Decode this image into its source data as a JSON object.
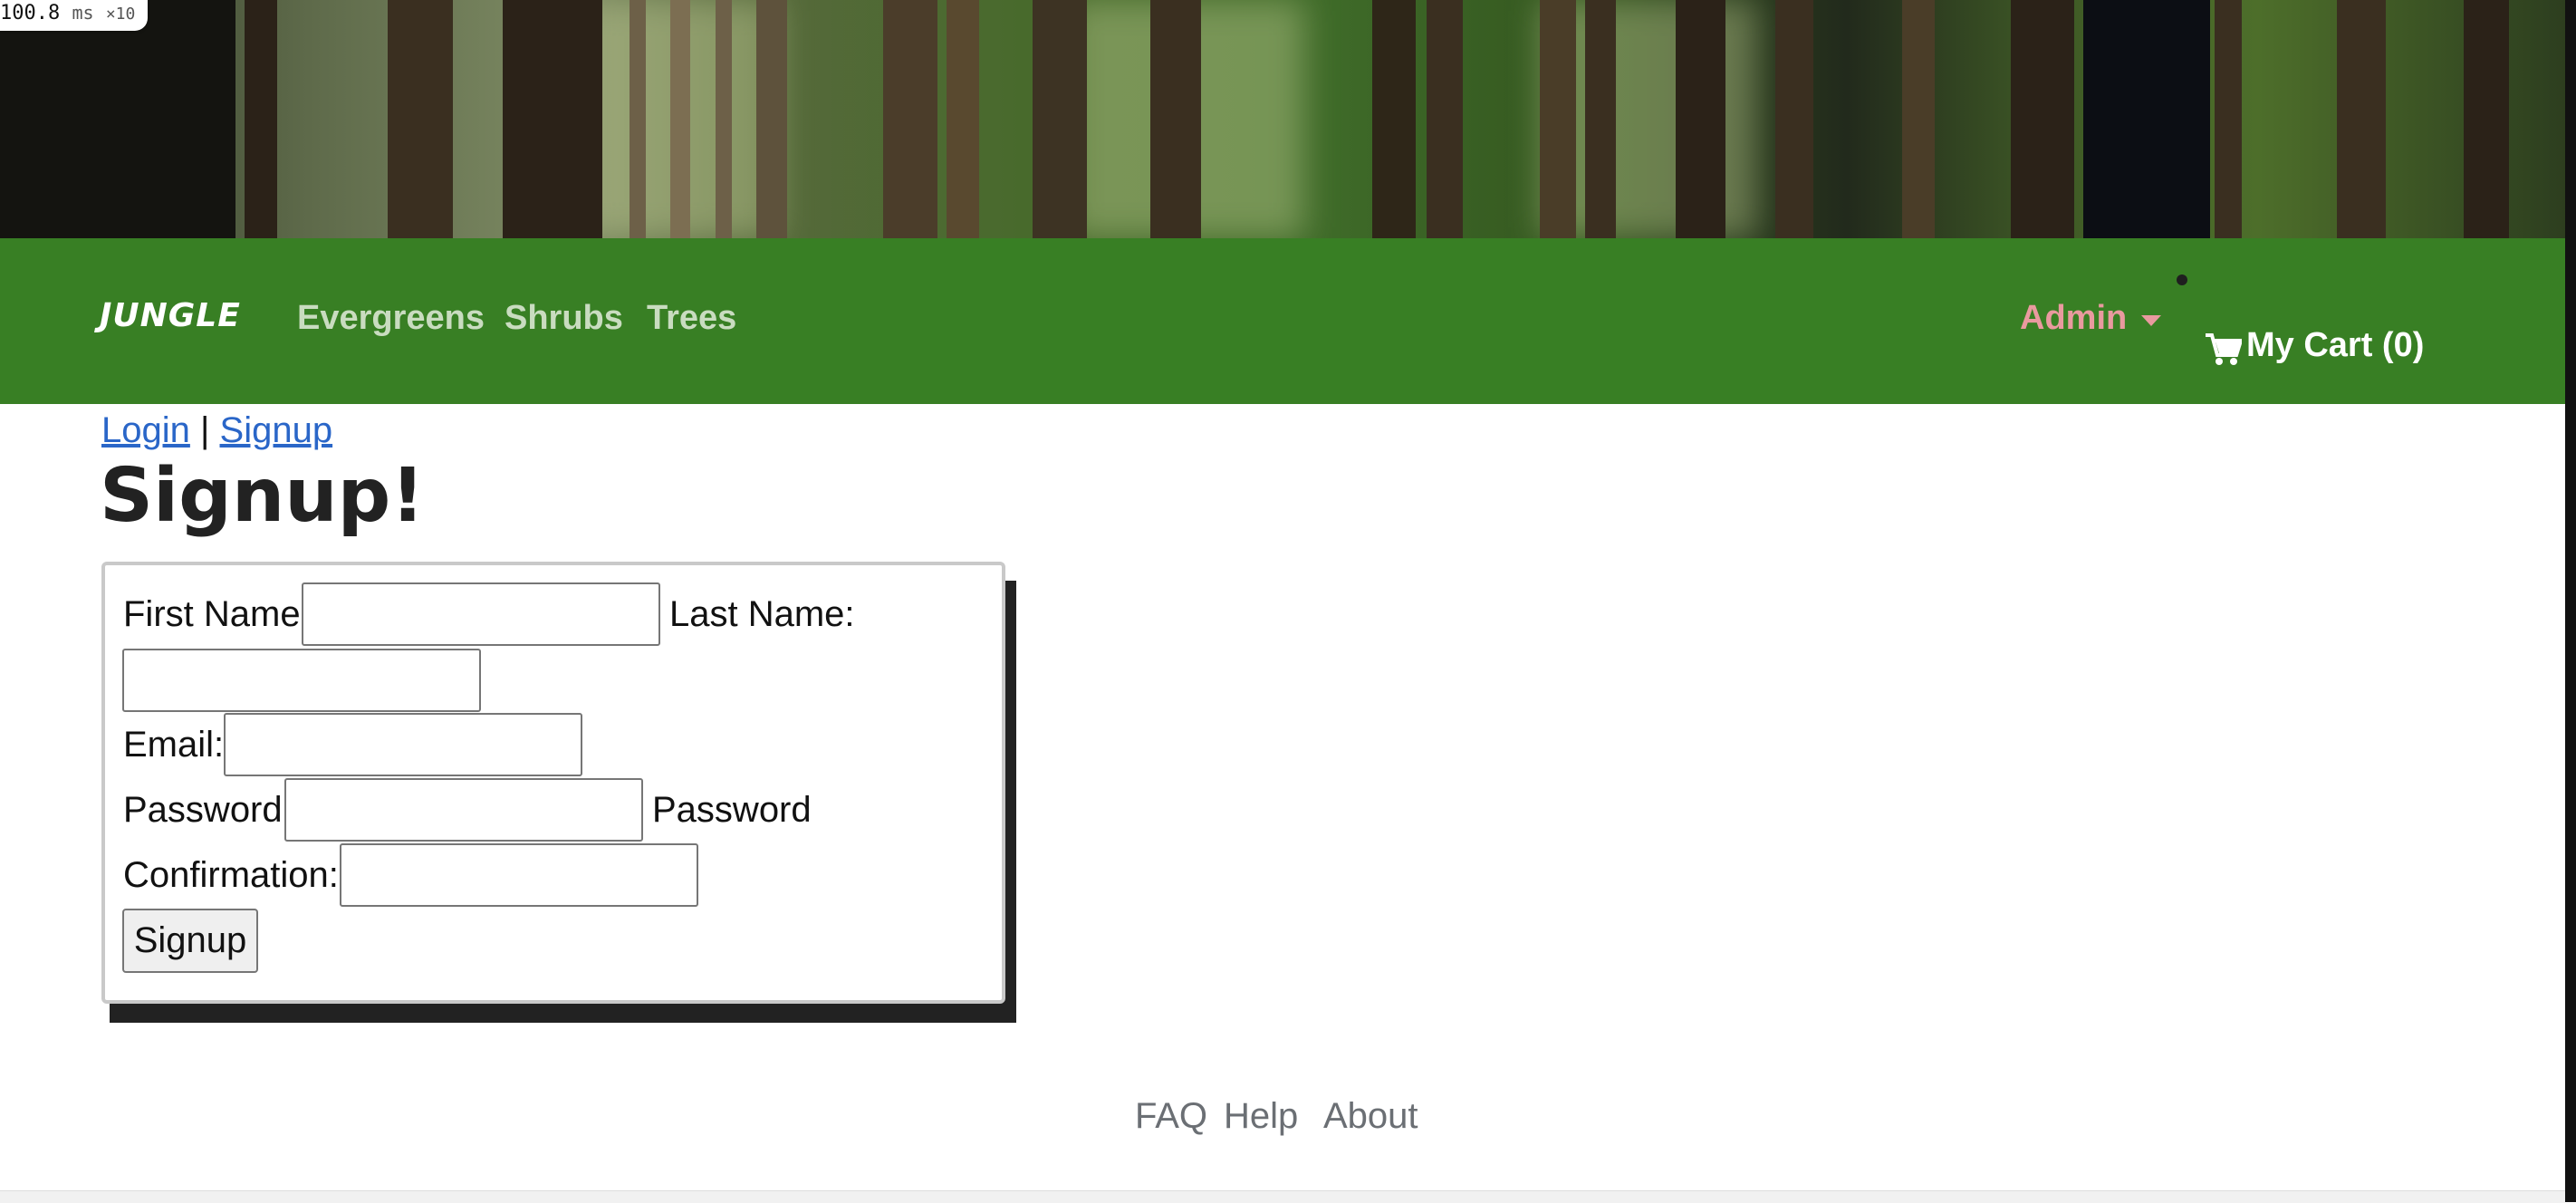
{
  "perf": {
    "value": "100.8",
    "unit": "ms",
    "multiplier": "×10"
  },
  "navbar": {
    "brand": "JUNGLE",
    "links": [
      "Evergreens",
      "Shrubs",
      "Trees"
    ],
    "admin_label": "Admin",
    "cart_label": "My Cart (0)",
    "colors": {
      "bar": "#387f24",
      "links": "#c9dcc0",
      "admin": "#e99a9f"
    }
  },
  "auth": {
    "login": "Login",
    "separator": "|",
    "signup": "Signup"
  },
  "page": {
    "title": "Signup!"
  },
  "form": {
    "first_name_label": "First Name:",
    "last_name_label": "Last Name:",
    "email_label": "Email:",
    "password_label": "Password:",
    "password_confirmation_label_1": "Password",
    "password_confirmation_label_2": "Confirmation:",
    "first_name_value": "",
    "last_name_value": "",
    "email_value": "",
    "password_value": "",
    "password_confirmation_value": "",
    "submit_label": "Signup"
  },
  "footer": {
    "links": [
      "FAQ",
      "Help",
      "About"
    ]
  },
  "icons": {
    "cart": "cart-icon",
    "admin_dropdown": "caret-down-icon"
  }
}
